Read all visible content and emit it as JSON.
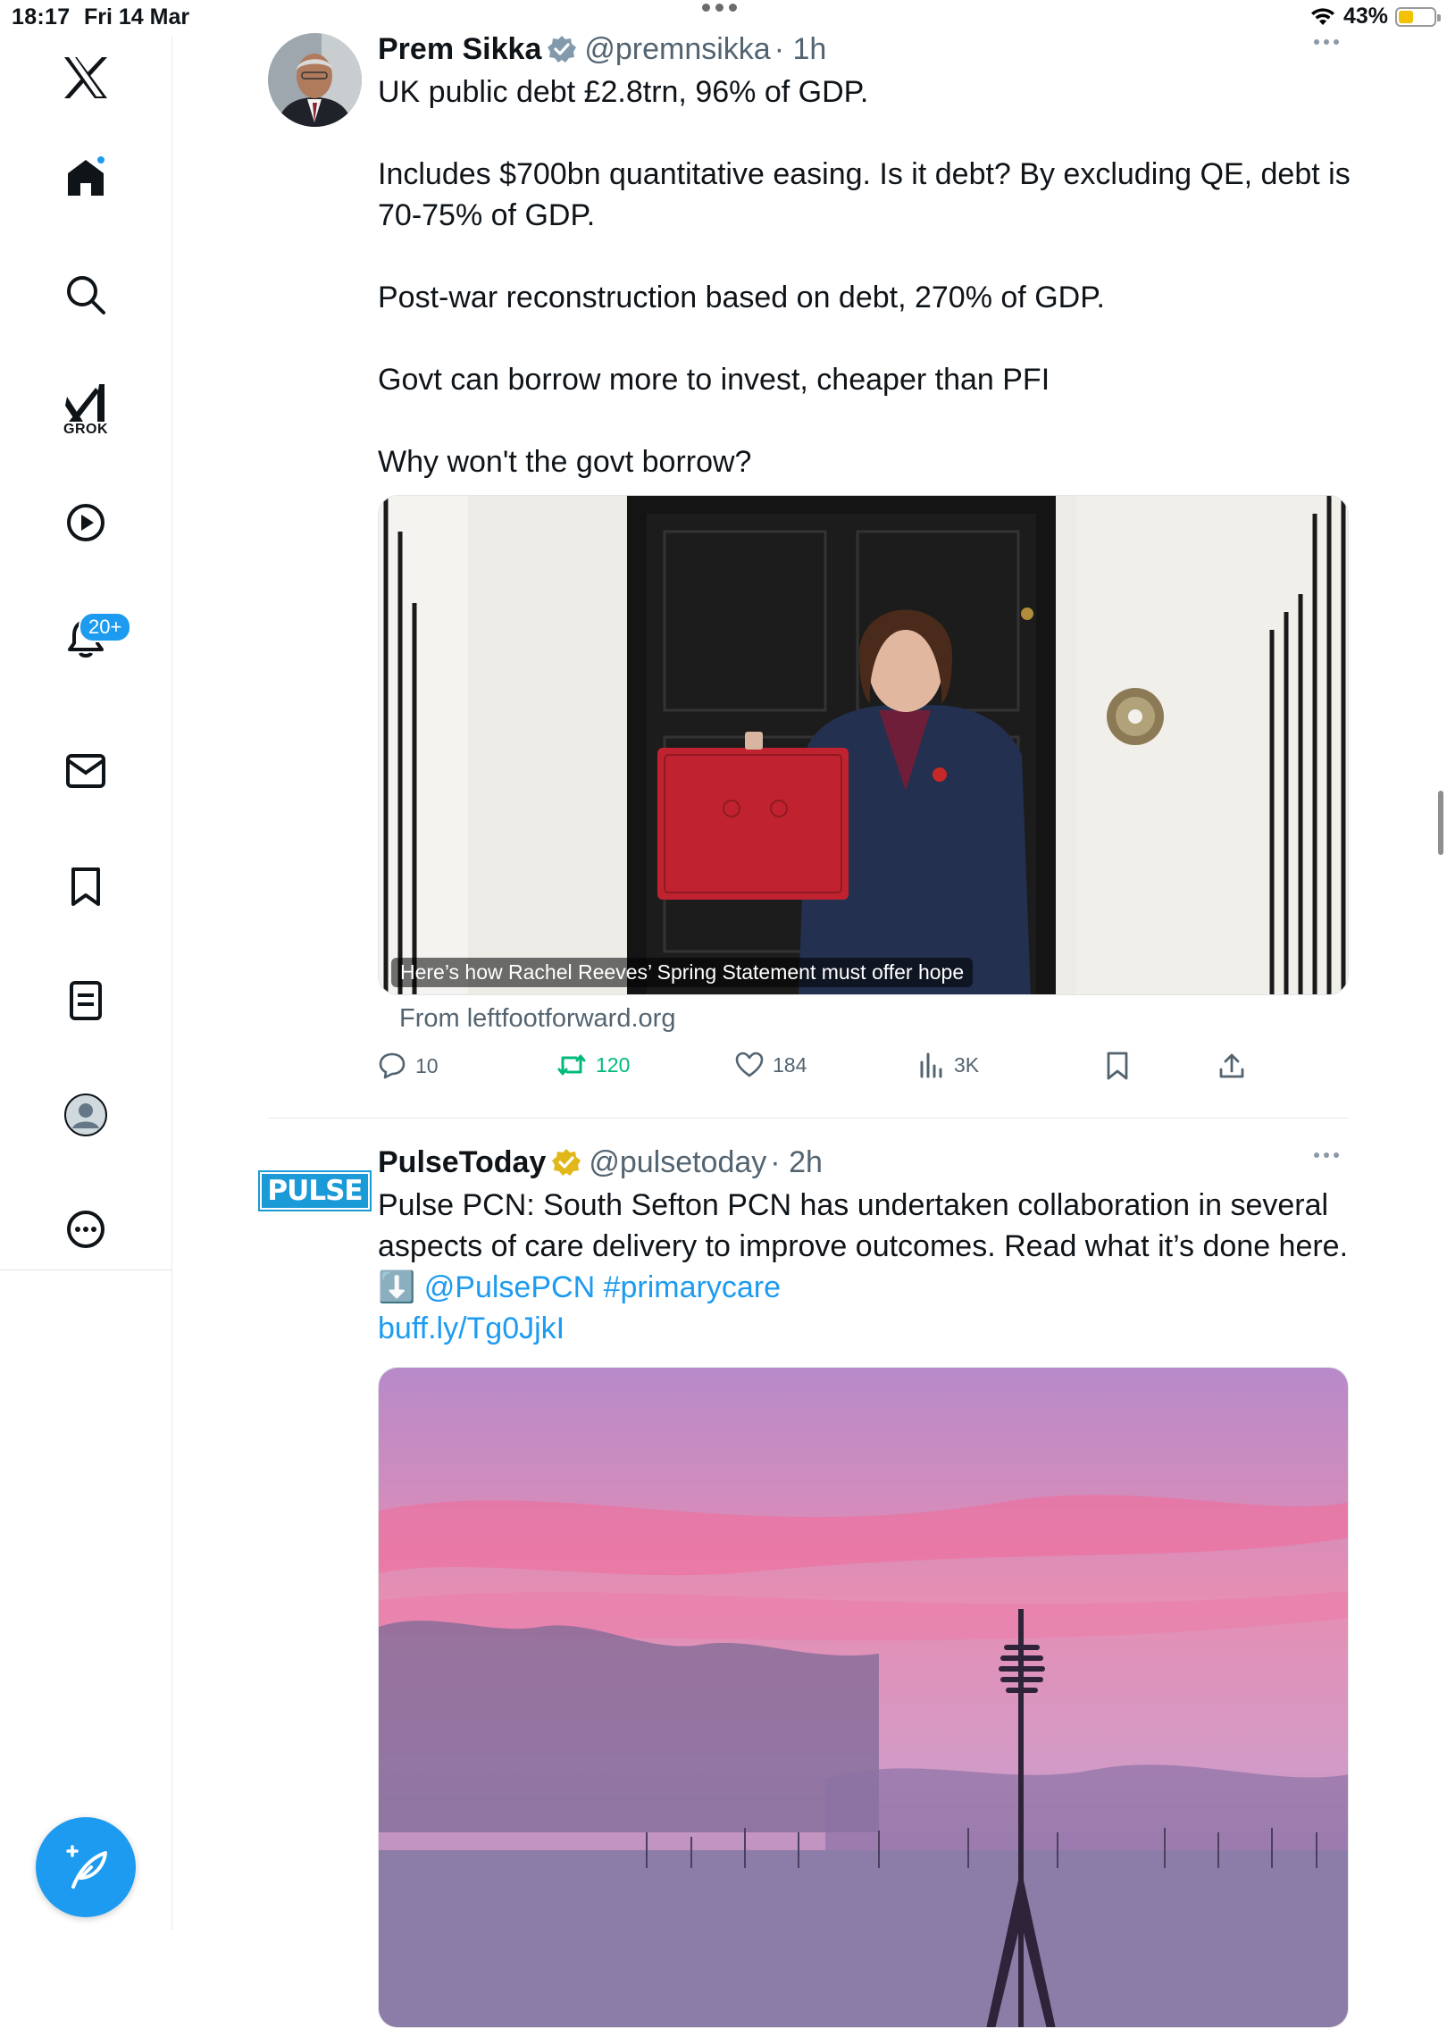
{
  "status_bar": {
    "time": "18:17",
    "date": "Fri 14 Mar",
    "battery_percent_text": "43%",
    "battery_level": 0.43
  },
  "sidebar": {
    "items": [
      {
        "name": "x-logo",
        "label": ""
      },
      {
        "name": "home",
        "label": ""
      },
      {
        "name": "explore",
        "label": ""
      },
      {
        "name": "grok",
        "label": "GROK"
      },
      {
        "name": "videos",
        "label": ""
      },
      {
        "name": "notifications",
        "label": ""
      },
      {
        "name": "messages",
        "label": ""
      },
      {
        "name": "bookmarks",
        "label": ""
      },
      {
        "name": "lists",
        "label": ""
      },
      {
        "name": "profile",
        "label": ""
      },
      {
        "name": "more",
        "label": ""
      }
    ],
    "notifications_badge": "20+"
  },
  "tweets": [
    {
      "name": "Prem Sikka",
      "handle": "@premnsikka",
      "time": "· 1h",
      "text": "UK public debt £2.8trn, 96% of GDP.\n\nIncludes $700bn quantitative easing. Is it debt? By excluding QE, debt is 70-75% of GDP.\n\nPost-war reconstruction based on debt, 270% of GDP.\n\nGovt can borrow more to invest, cheaper than PFI\n\nWhy won't the govt borrow?",
      "card_caption": "Here’s how Rachel Reeves’ Spring Statement must offer hope",
      "card_source": "From leftfootforward.org",
      "replies": "10",
      "reposts": "120",
      "likes": "184",
      "views": "3K"
    },
    {
      "name": "PulseToday",
      "handle": "@pulsetoday",
      "time": "· 2h",
      "logo_text": "PULSE",
      "text": "Pulse PCN: South Sefton PCN has undertaken collaboration in several aspects of care delivery to improve outcomes. Read what it’s done here. ⬇️ ",
      "mention": "@PulsePCN",
      "hashtag": "#primarycare",
      "url": "buff.ly/Tg0JjkI"
    }
  ],
  "colors": {
    "accent": "#1d9bf0",
    "repost_active": "#00ba7c",
    "text_secondary": "#536471",
    "gold_verified": "#e2b719"
  }
}
